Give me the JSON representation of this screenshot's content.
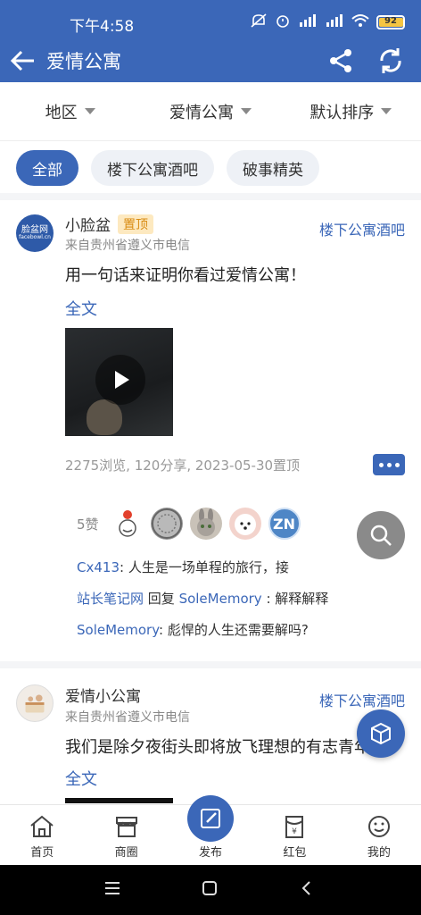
{
  "status_bar": {
    "time": "下午4:58",
    "battery": "92"
  },
  "app_bar": {
    "title": "爱情公寓"
  },
  "filters": [
    {
      "label": "地区"
    },
    {
      "label": "爱情公寓"
    },
    {
      "label": "默认排序"
    }
  ],
  "chips": [
    {
      "label": "全部",
      "active": true
    },
    {
      "label": "楼下公寓酒吧",
      "active": false
    },
    {
      "label": "破事精英",
      "active": false
    }
  ],
  "posts": [
    {
      "user": "小脸盆",
      "badge": "置顶",
      "avatar_text": "脸盆网",
      "avatar_sub": "facebowl.cn",
      "location": "来自贵州省遵义市电信",
      "board": "楼下公寓酒吧",
      "content": "用一句话来证明你看过爱情公寓！",
      "fulltext": "全文",
      "stats": "2275浏览, 120分享, 2023-05-30置顶",
      "likes_label": "5赞",
      "likers": [
        "🌸",
        "",
        "",
        "",
        "ZN"
      ],
      "comments": [
        {
          "user": "Cx413",
          "sep": ": ",
          "text": "人生是一场单程的旅行，接"
        },
        {
          "user": "站长笔记网",
          "reply": " 回复 ",
          "target": "SoleMemory",
          "sep": " : ",
          "text": "解释解释"
        },
        {
          "user": "SoleMemory",
          "sep": ": ",
          "text": "彪悍的人生还需要解吗?"
        }
      ]
    },
    {
      "user": "爱情小公寓",
      "location": "来自贵州省遵义市电信",
      "board": "楼下公寓酒吧",
      "content": "我们是除夕夜街头即将放飞理想的有志青年",
      "fulltext": "全文"
    }
  ],
  "bottom_nav": [
    {
      "label": "首页",
      "icon": "home-icon"
    },
    {
      "label": "商圈",
      "icon": "store-icon"
    },
    {
      "label": "发布",
      "icon": "edit-icon"
    },
    {
      "label": "红包",
      "icon": "red-packet-icon"
    },
    {
      "label": "我的",
      "icon": "smiley-icon"
    }
  ],
  "colors": {
    "primary": "#3b67b8",
    "link": "#3b67b8",
    "pin_badge": "#fde9c0"
  }
}
